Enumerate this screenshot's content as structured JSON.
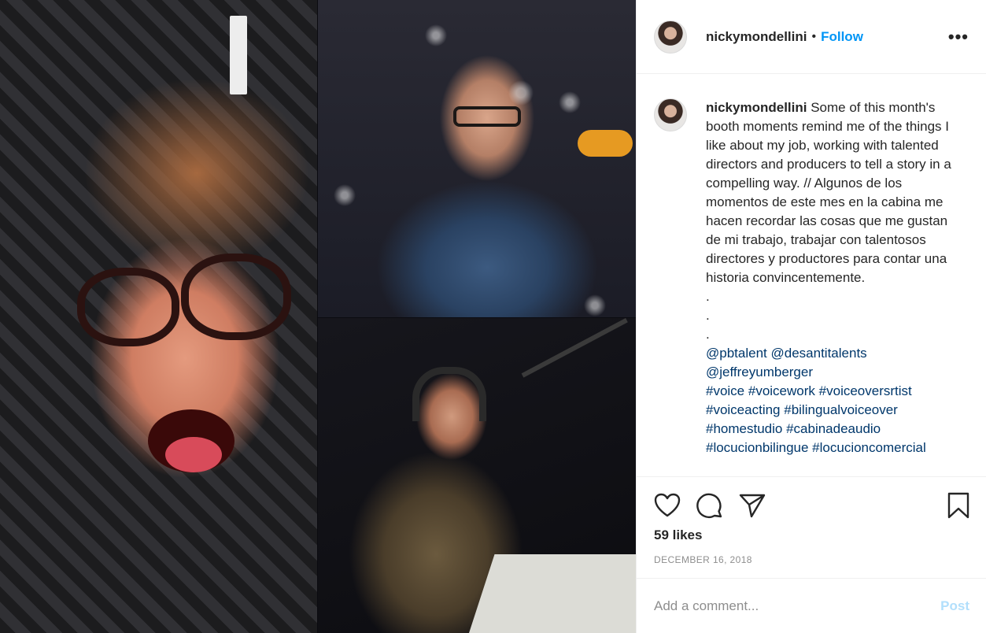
{
  "post": {
    "username": "nickymondellini",
    "follow_label": "Follow",
    "separator": "•",
    "more_icon": "more-options-icon",
    "more_label": "•••"
  },
  "caption": {
    "username": "nickymondellini",
    "text": "Some of this month's booth moments remind me of the things I like about my job, working with talented directors and producers to tell a story in a compelling way. // Algunos de los momentos de este mes en la cabina me hacen recordar las cosas que me gustan de mi trabajo, trabajar con talentosos directores y productores para contar una historia convincentemente.",
    "dots": [
      ".",
      ".",
      "."
    ],
    "mentions": [
      "@pbtalent",
      "@desantitalents",
      "@jeffreyumberger"
    ],
    "hashtags": [
      "#voice",
      "#voicework",
      "#voiceoversrtist",
      "#voiceacting",
      "#bilingualvoiceover",
      "#homestudio",
      "#cabinadeaudio",
      "#locucionbilingue",
      "#locucioncomercial"
    ]
  },
  "actions": {
    "icons": [
      "heart-icon",
      "comment-icon",
      "share-icon",
      "bookmark-icon"
    ],
    "likes": "59 likes",
    "date": "DECEMBER 16, 2018"
  },
  "comment": {
    "placeholder": "Add a comment...",
    "post_label": "Post"
  },
  "colors": {
    "link_blue": "#0095f6",
    "tag_blue": "#00376b",
    "muted": "#8e8e8e",
    "post_disabled": "#b2dffc"
  }
}
